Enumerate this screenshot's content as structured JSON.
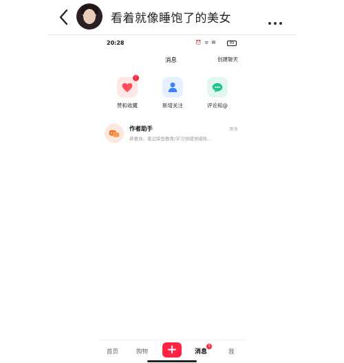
{
  "chat_header": {
    "title": "看着就像睡饱了的美女",
    "back_icon": "chevron-left-icon",
    "more_icon": "more-dots-icon"
  },
  "status_bar": {
    "time": "20:28",
    "icons": "⏰ ᯤ ✉",
    "battery": "89"
  },
  "messages_page": {
    "title": "消息",
    "create_chat": "创建聊天",
    "quick_entries": [
      {
        "label": "赞和收藏",
        "icon": "heart-icon",
        "color": "#ff4d5a",
        "badge": "!"
      },
      {
        "label": "新增关注",
        "icon": "person-icon",
        "color": "#3b82f6"
      },
      {
        "label": "评论和@",
        "icon": "comment-icon",
        "color": "#22c58b"
      }
    ],
    "conversations": [
      {
        "name": "作者助手",
        "time": "昨天",
        "snippet": "恭喜你，笔记荣登教育/学习领域领域热…"
      }
    ]
  },
  "bottom_nav": {
    "home": "首页",
    "shop": "购物",
    "plus": "+",
    "messages": "消息",
    "messages_badge": "3",
    "me": "我"
  }
}
